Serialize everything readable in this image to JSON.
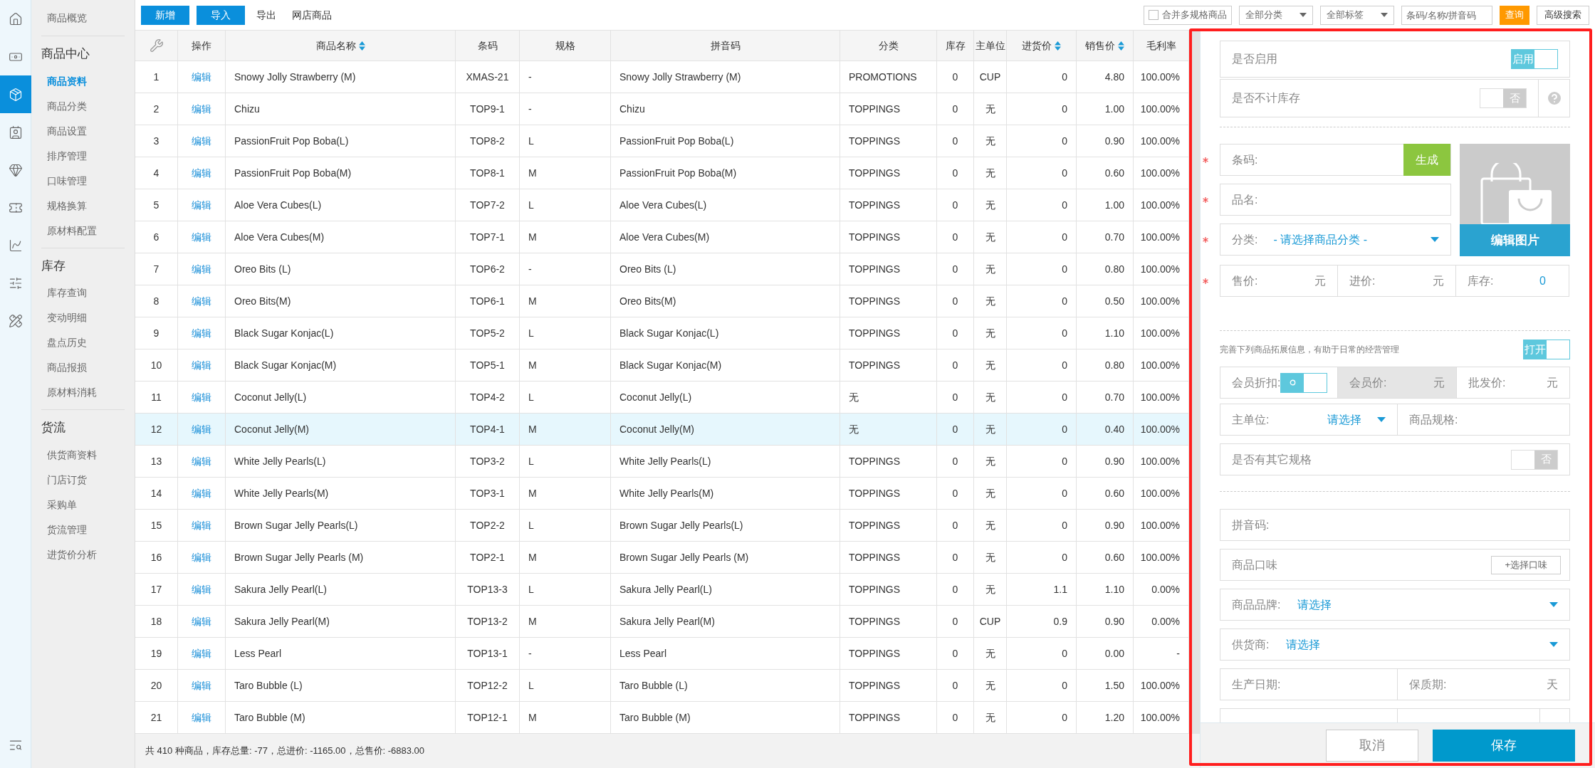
{
  "rail": [
    {
      "selected": false
    },
    {
      "selected": false
    },
    {
      "selected": true
    },
    {
      "selected": false
    },
    {
      "selected": false
    },
    {
      "selected": false
    },
    {
      "selected": false
    },
    {
      "selected": false
    },
    {
      "selected": false
    },
    {
      "selected": false
    }
  ],
  "subnav": {
    "top": {
      "label": "商品概览",
      "selected": false
    },
    "groups": [
      {
        "title": "商品中心",
        "items": [
          {
            "label": "商品资料",
            "selected": true
          },
          {
            "label": "商品分类",
            "selected": false
          },
          {
            "label": "商品设置",
            "selected": false
          },
          {
            "label": "排序管理",
            "selected": false
          },
          {
            "label": "口味管理",
            "selected": false
          },
          {
            "label": "规格换算",
            "selected": false
          },
          {
            "label": "原材料配置",
            "selected": false
          }
        ]
      },
      {
        "title": "库存",
        "items": [
          {
            "label": "库存查询",
            "selected": false
          },
          {
            "label": "变动明细",
            "selected": false
          },
          {
            "label": "盘点历史",
            "selected": false
          },
          {
            "label": "商品报损",
            "selected": false
          },
          {
            "label": "原材料消耗",
            "selected": false
          }
        ]
      },
      {
        "title": "货流",
        "items": [
          {
            "label": "供货商资料",
            "selected": false
          },
          {
            "label": "门店订货",
            "selected": false
          },
          {
            "label": "采购单",
            "selected": false
          },
          {
            "label": "货流管理",
            "selected": false
          },
          {
            "label": "进货价分析",
            "selected": false
          }
        ]
      }
    ]
  },
  "toolbar": {
    "buttons": [
      "新增",
      "导入"
    ],
    "links": [
      "导出",
      "网店商品"
    ],
    "merge": {
      "label": "合并多规格商品",
      "checked": false
    },
    "selects": [
      "全部分类",
      "全部标签"
    ],
    "search": {
      "placeholder": "条码/名称/拼音码"
    },
    "query": "查询",
    "advanced": "高级搜索"
  },
  "table": {
    "columns": [
      {
        "kind": "tools"
      },
      {
        "label": "操作",
        "sortable": false
      },
      {
        "label": "商品名称",
        "sortable": true
      },
      {
        "label": "条码",
        "sortable": false
      },
      {
        "label": "规格",
        "sortable": false
      },
      {
        "label": "拼音码",
        "sortable": false
      },
      {
        "label": "分类",
        "sortable": false
      },
      {
        "label": "库存",
        "sortable": false
      },
      {
        "label": "主单位",
        "sortable": false
      },
      {
        "label": "进货价",
        "sortable": true
      },
      {
        "label": "销售价",
        "sortable": true
      },
      {
        "label": "毛利率",
        "sortable": false
      }
    ],
    "rows": [
      {
        "selected": false,
        "cells": [
          "1",
          "编辑",
          "Snowy Jolly Strawberry (M)",
          "XMAS-21",
          "-",
          "Snowy Jolly Strawberry (M)",
          "PROMOTIONS",
          "0",
          "CUP",
          "0",
          "4.80",
          "100.00%"
        ]
      },
      {
        "selected": false,
        "cells": [
          "2",
          "编辑",
          "Chizu",
          "TOP9-1",
          "-",
          "Chizu",
          "TOPPINGS",
          "0",
          "无",
          "0",
          "1.00",
          "100.00%"
        ]
      },
      {
        "selected": false,
        "cells": [
          "3",
          "编辑",
          "PassionFruit Pop Boba(L)",
          "TOP8-2",
          "L",
          "PassionFruit Pop Boba(L)",
          "TOPPINGS",
          "0",
          "无",
          "0",
          "0.90",
          "100.00%"
        ]
      },
      {
        "selected": false,
        "cells": [
          "4",
          "编辑",
          "PassionFruit Pop Boba(M)",
          "TOP8-1",
          "M",
          "PassionFruit Pop Boba(M)",
          "TOPPINGS",
          "0",
          "无",
          "0",
          "0.60",
          "100.00%"
        ]
      },
      {
        "selected": false,
        "cells": [
          "5",
          "编辑",
          "Aloe Vera Cubes(L)",
          "TOP7-2",
          "L",
          "Aloe Vera Cubes(L)",
          "TOPPINGS",
          "0",
          "无",
          "0",
          "1.00",
          "100.00%"
        ]
      },
      {
        "selected": false,
        "cells": [
          "6",
          "编辑",
          "Aloe Vera Cubes(M)",
          "TOP7-1",
          "M",
          "Aloe Vera Cubes(M)",
          "TOPPINGS",
          "0",
          "无",
          "0",
          "0.70",
          "100.00%"
        ]
      },
      {
        "selected": false,
        "cells": [
          "7",
          "编辑",
          "Oreo Bits (L)",
          "TOP6-2",
          "-",
          "Oreo Bits (L)",
          "TOPPINGS",
          "0",
          "无",
          "0",
          "0.80",
          "100.00%"
        ]
      },
      {
        "selected": false,
        "cells": [
          "8",
          "编辑",
          "Oreo Bits(M)",
          "TOP6-1",
          "M",
          "Oreo Bits(M)",
          "TOPPINGS",
          "0",
          "无",
          "0",
          "0.50",
          "100.00%"
        ]
      },
      {
        "selected": false,
        "cells": [
          "9",
          "编辑",
          "Black Sugar Konjac(L)",
          "TOP5-2",
          "L",
          "Black Sugar Konjac(L)",
          "TOPPINGS",
          "0",
          "无",
          "0",
          "1.10",
          "100.00%"
        ]
      },
      {
        "selected": false,
        "cells": [
          "10",
          "编辑",
          "Black Sugar Konjac(M)",
          "TOP5-1",
          "M",
          "Black Sugar Konjac(M)",
          "TOPPINGS",
          "0",
          "无",
          "0",
          "0.80",
          "100.00%"
        ]
      },
      {
        "selected": false,
        "cells": [
          "11",
          "编辑",
          "Coconut Jelly(L)",
          "TOP4-2",
          "L",
          "Coconut Jelly(L)",
          "无",
          "0",
          "无",
          "0",
          "0.70",
          "100.00%"
        ]
      },
      {
        "selected": true,
        "cells": [
          "12",
          "编辑",
          "Coconut Jelly(M)",
          "TOP4-1",
          "M",
          "Coconut Jelly(M)",
          "无",
          "0",
          "无",
          "0",
          "0.40",
          "100.00%"
        ]
      },
      {
        "selected": false,
        "cells": [
          "13",
          "编辑",
          "White Jelly Pearls(L)",
          "TOP3-2",
          "L",
          "White Jelly Pearls(L)",
          "TOPPINGS",
          "0",
          "无",
          "0",
          "0.90",
          "100.00%"
        ]
      },
      {
        "selected": false,
        "cells": [
          "14",
          "编辑",
          "White Jelly Pearls(M)",
          "TOP3-1",
          "M",
          "White Jelly Pearls(M)",
          "TOPPINGS",
          "0",
          "无",
          "0",
          "0.60",
          "100.00%"
        ]
      },
      {
        "selected": false,
        "cells": [
          "15",
          "编辑",
          "Brown Sugar Jelly Pearls(L)",
          "TOP2-2",
          "L",
          "Brown Sugar Jelly Pearls(L)",
          "TOPPINGS",
          "0",
          "无",
          "0",
          "0.90",
          "100.00%"
        ]
      },
      {
        "selected": false,
        "cells": [
          "16",
          "编辑",
          "Brown Sugar Jelly Pearls (M)",
          "TOP2-1",
          "M",
          "Brown Sugar Jelly Pearls (M)",
          "TOPPINGS",
          "0",
          "无",
          "0",
          "0.60",
          "100.00%"
        ]
      },
      {
        "selected": false,
        "cells": [
          "17",
          "编辑",
          "Sakura Jelly Pearl(L)",
          "TOP13-3",
          "L",
          "Sakura Jelly Pearl(L)",
          "TOPPINGS",
          "0",
          "无",
          "1.1",
          "1.10",
          "0.00%"
        ]
      },
      {
        "selected": false,
        "cells": [
          "18",
          "编辑",
          "Sakura Jelly Pearl(M)",
          "TOP13-2",
          "M",
          "Sakura Jelly Pearl(M)",
          "TOPPINGS",
          "0",
          "CUP",
          "0.9",
          "0.90",
          "0.00%"
        ]
      },
      {
        "selected": false,
        "cells": [
          "19",
          "编辑",
          "Less Pearl",
          "TOP13-1",
          "-",
          "Less Pearl",
          "TOPPINGS",
          "0",
          "无",
          "0",
          "0.00",
          "-"
        ]
      },
      {
        "selected": false,
        "cells": [
          "20",
          "编辑",
          "Taro Bubble (L)",
          "TOP12-2",
          "L",
          "Taro Bubble (L)",
          "TOPPINGS",
          "0",
          "无",
          "0",
          "1.50",
          "100.00%"
        ]
      },
      {
        "selected": false,
        "cells": [
          "21",
          "编辑",
          "Taro Bubble (M)",
          "TOP12-1",
          "M",
          "Taro Bubble (M)",
          "TOPPINGS",
          "0",
          "无",
          "0",
          "1.20",
          "100.00%"
        ]
      }
    ]
  },
  "summary": "共 410 种商品，库存总量: -77，总进价: -1165.00，总售价: -6883.00",
  "drawer": {
    "enabled": {
      "label": "是否启用",
      "on": true,
      "text": "启用"
    },
    "no_stock": {
      "label": "是否不计库存",
      "on": false,
      "text": "否"
    },
    "barcode": {
      "label": "条码:",
      "required": true,
      "button": "生成"
    },
    "name": {
      "label": "品名:",
      "required": true
    },
    "category": {
      "label": "分类:",
      "required": true,
      "value": "- 请选择商品分类 -"
    },
    "image_button": "编辑图片",
    "prices": {
      "required": true,
      "fields": [
        {
          "label": "售价:",
          "unit": "元"
        },
        {
          "label": "进价:",
          "unit": "元"
        },
        {
          "label": "库存:",
          "value": "0"
        }
      ]
    },
    "extended": {
      "hint": "完善下列商品拓展信息，有助于日常的经营管理",
      "on": true,
      "text": "打开"
    },
    "member": [
      {
        "kind": "toggle",
        "label": "会员折扣:",
        "on": true
      },
      {
        "kind": "unit",
        "label": "会员价:",
        "unit": "元",
        "disabled": true
      },
      {
        "kind": "unit",
        "label": "批发价:",
        "unit": "元",
        "disabled": false
      }
    ],
    "unit_row": [
      {
        "kind": "select",
        "label": "主单位:",
        "value": "请选择"
      },
      {
        "kind": "text",
        "label": "商品规格:"
      }
    ],
    "other_spec": {
      "label": "是否有其它规格",
      "on": false,
      "text": "否"
    },
    "pinyin": {
      "label": "拼音码:"
    },
    "flavor": {
      "label": "商品口味",
      "button": "+选择口味"
    },
    "brand": {
      "label": "商品品牌:",
      "value": "请选择"
    },
    "supplier": {
      "label": "供货商:",
      "value": "请选择"
    },
    "dates": [
      {
        "label": "生产日期:"
      },
      {
        "label": "保质期:",
        "unit": "天"
      }
    ],
    "cancel": "取消",
    "save": "保存"
  }
}
